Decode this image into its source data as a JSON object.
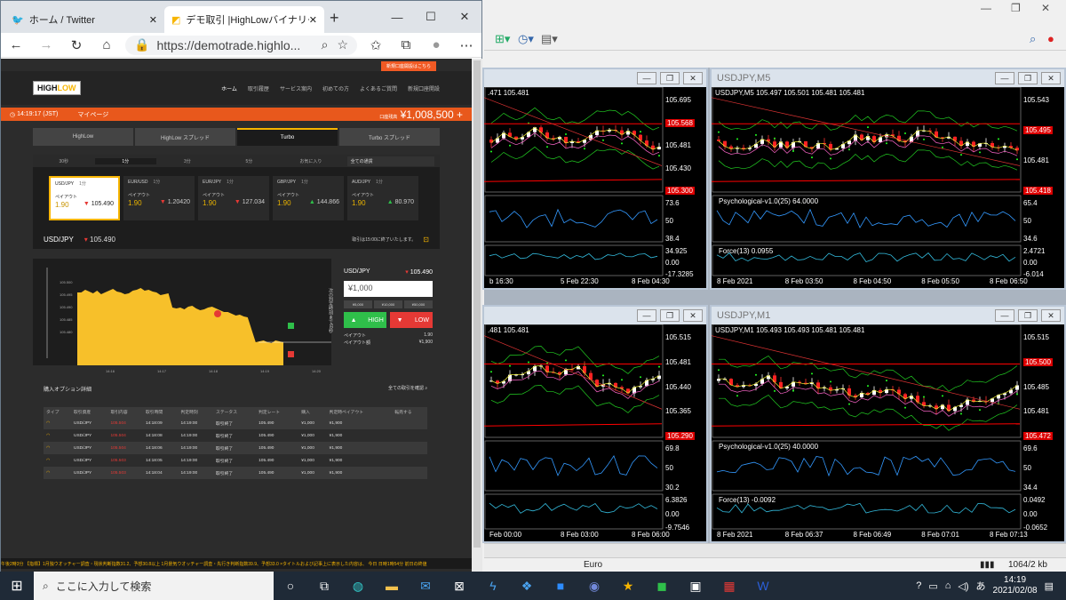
{
  "browser": {
    "tab1": "ホーム / Twitter",
    "tab2": "デモ取引 |HighLowバイナリーオプシ",
    "url": "https://demotrade.highlo...",
    "site": {
      "register": "新規口座開設はこちら",
      "logo_a": "HIGH",
      "logo_b": "LOW",
      "nav": [
        "ホーム",
        "取引履歴",
        "サービス案内",
        "初めての方",
        "よくあるご質問",
        "新規口座開設"
      ],
      "time": "14:19:17 (JST)",
      "mypage": "マイページ",
      "balance_label": "口座残高",
      "balance": "¥1,008,500",
      "opt_tabs": [
        "HighLow",
        "HighLow スプレッド",
        "Turbo",
        "Turbo スプレッド"
      ],
      "durations": [
        "30秒",
        "1分",
        "3分",
        "5分",
        "お気に入り"
      ],
      "dur_active": "1分",
      "select": "全ての通貨",
      "assets": [
        {
          "pair": "USD/JPY",
          "t": "1分",
          "payout": "1.90",
          "rate": "105.490",
          "dir": "dn"
        },
        {
          "pair": "EUR/USD",
          "t": "1分",
          "payout": "1.90",
          "rate": "1.20420",
          "dir": "dn"
        },
        {
          "pair": "EUR/JPY",
          "t": "1分",
          "payout": "1.90",
          "rate": "127.034",
          "dir": "dn"
        },
        {
          "pair": "GBP/JPY",
          "t": "1分",
          "payout": "1.90",
          "rate": "144.866",
          "dir": "up"
        },
        {
          "pair": "AUD/JPY",
          "t": "1分",
          "payout": "1.90",
          "rate": "80.970",
          "dir": "up"
        }
      ],
      "payout_label": "ペイアウト",
      "pair": "USD/JPY",
      "pair_rate": "105.490",
      "note": "取引は15:00に終了いたします。",
      "trade": {
        "pair": "USD/JPY",
        "rate": "105.490",
        "amount": "¥1,000",
        "quick": [
          "¥5,000",
          "¥10,000",
          "¥50,000"
        ],
        "high": "HIGH",
        "low": "LOW",
        "payout": "ペイアウト",
        "payout_v": "1.90",
        "payout_amt": "ペイアウト額",
        "payout_amt_v": "¥1,900",
        "vertical": "次の判定時刻まで60秒"
      },
      "chart_ticks": [
        "105.500",
        "105.495",
        "105.490",
        "105.485",
        "105.480"
      ],
      "chart_times": [
        "14:16",
        "14:17",
        "14:18",
        "14:19",
        "14:20"
      ],
      "hist_title": "購入オプション詳細",
      "hist_all": "全ての取引を確認",
      "hist_cols": [
        "タイプ",
        "取引資産",
        "取引内容",
        "取引時間",
        "判定時刻",
        "ステータス",
        "判定レート",
        "購入",
        "判定時ペイアウト",
        "転売する"
      ],
      "hist_rows": [
        [
          "USD/JPY",
          "105.504",
          "14:18:09",
          "14:19:00",
          "取引終了",
          "105.490",
          "¥1,000",
          "¥1,900"
        ],
        [
          "USD/JPY",
          "105.504",
          "14:18:08",
          "14:19:00",
          "取引終了",
          "105.490",
          "¥1,000",
          "¥1,900"
        ],
        [
          "USD/JPY",
          "105.504",
          "14:18:06",
          "14:19:00",
          "取引終了",
          "105.490",
          "¥1,000",
          "¥1,900"
        ],
        [
          "USD/JPY",
          "105.503",
          "14:18:05",
          "14:19:00",
          "取引終了",
          "105.490",
          "¥1,000",
          "¥1,900"
        ],
        [
          "USD/JPY",
          "105.503",
          "14:18:04",
          "14:19:00",
          "取引終了",
          "105.490",
          "¥1,000",
          "¥1,900"
        ]
      ],
      "ticker": "午後2時3分 【指標】1月独ウオッチャー調査・現状判断指数31.2、予想30.8以上 1月景気ウオッチャー調査・先行き判断指数39.9、予想33.0 ×タイトルおよび記事上に表示した内容は、 今日 日時1時54分 前日の終値"
    }
  },
  "mt4": {
    "status": "Euro",
    "kb": "1064/2 kb",
    "charts": [
      {
        "title": "",
        "header": ".471 105.481",
        "prices": [
          "105.695",
          "105.568",
          "105.481",
          "105.430",
          "105.300"
        ],
        "ind1": "",
        "ind1v": [
          "73.6",
          "50",
          "38.4"
        ],
        "ind2": "",
        "ind2v": [
          "34.925",
          "0.00",
          "-17.3285"
        ],
        "times": [
          "b 16:30",
          "5 Feb 22:30",
          "8 Feb 04:30"
        ]
      },
      {
        "title": "USDJPY,M5",
        "header": "USDJPY,M5  105.497 105.501 105.481 105.481",
        "prices": [
          "105.543",
          "105.495",
          "105.481",
          "105.418"
        ],
        "ind1": "Psychological-v1.0(25) 64.0000",
        "ind1v": [
          "65.4",
          "50",
          "34.6"
        ],
        "ind2": "Force(13) 0.0955",
        "ind2v": [
          "2.4721",
          "0.00",
          "-6.014"
        ],
        "times": [
          "8 Feb 2021",
          "8 Feb 03:50",
          "8 Feb 04:50",
          "8 Feb 05:50",
          "8 Feb 06:50"
        ]
      },
      {
        "title": "",
        "header": ".481 105.481",
        "prices": [
          "105.515",
          "105.481",
          "105.440",
          "105.365",
          "105.290"
        ],
        "ind1": "",
        "ind1v": [
          "69.8",
          "50",
          "30.2"
        ],
        "ind2": "",
        "ind2v": [
          "6.3826",
          "0.00",
          "-9.7546"
        ],
        "times": [
          "Feb 00:00",
          "8 Feb 03:00",
          "8 Feb 06:00"
        ]
      },
      {
        "title": "USDJPY,M1",
        "header": "USDJPY,M1  105.493 105.493 105.481 105.481",
        "prices": [
          "105.515",
          "105.500",
          "105.485",
          "105.481",
          "105.472"
        ],
        "ind1": "Psychological-v1.0(25) 40.0000",
        "ind1v": [
          "69.6",
          "50",
          "34.4"
        ],
        "ind2": "Force(13) -0.0092",
        "ind2v": [
          "0.0492",
          "0.00",
          "-0.0652"
        ],
        "times": [
          "8 Feb 2021",
          "8 Feb 06:37",
          "8 Feb 06:49",
          "8 Feb 07:01",
          "8 Feb 07:13"
        ]
      }
    ]
  },
  "taskbar": {
    "search": "ここに入力して検索",
    "time": "14:19",
    "date": "2021/02/08"
  },
  "colors": {
    "orange": "#e8581c",
    "gold": "#f7b500",
    "high": "#2fbf4a",
    "low": "#e53935"
  }
}
